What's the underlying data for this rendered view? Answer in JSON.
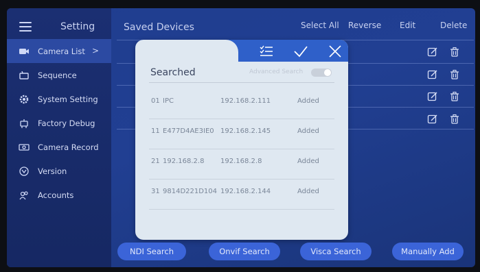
{
  "sidebar": {
    "title": "Setting",
    "items": [
      {
        "label": "Camera List",
        "icon": "camera-icon",
        "active": true,
        "chevron": ">"
      },
      {
        "label": "Sequence",
        "icon": "sequence-icon"
      },
      {
        "label": "System Setting",
        "icon": "gear-icon"
      },
      {
        "label": "Factory Debug",
        "icon": "robot-icon"
      },
      {
        "label": "Camera Record",
        "icon": "record-icon"
      },
      {
        "label": "Version",
        "icon": "version-icon"
      },
      {
        "label": "Accounts",
        "icon": "accounts-icon"
      }
    ]
  },
  "header": {
    "title": "Saved Devices",
    "actions": [
      "Select All",
      "Reverse",
      "Edit",
      "Delete"
    ]
  },
  "dialog": {
    "title": "Searched",
    "advanced_search_label": "Advanced Search",
    "advanced_search_on": false,
    "results": [
      {
        "index": "01",
        "name": "IPC",
        "ip": "192.168.2.111",
        "status": "Added"
      },
      {
        "index": "11",
        "name": "E477D4AE3IE0",
        "ip": "192.168.2.145",
        "status": "Added"
      },
      {
        "index": "21",
        "name": "192.168.2.8",
        "ip": "192.168.2.8",
        "status": "Added"
      },
      {
        "index": "31",
        "name": "9814D221D104",
        "ip": "192.168.2.144",
        "status": "Added"
      }
    ]
  },
  "bottom_buttons": {
    "ndi": "NDI Search",
    "onvif": "Onvif Search",
    "visca": "Visca Search",
    "manual": "Manually Add"
  },
  "colors": {
    "background": "#213f92",
    "sidebar": "#1b2f72",
    "dialog_header": "#2f60c9",
    "dialog_body": "#dfe8f1",
    "button": "#3b64d8"
  }
}
